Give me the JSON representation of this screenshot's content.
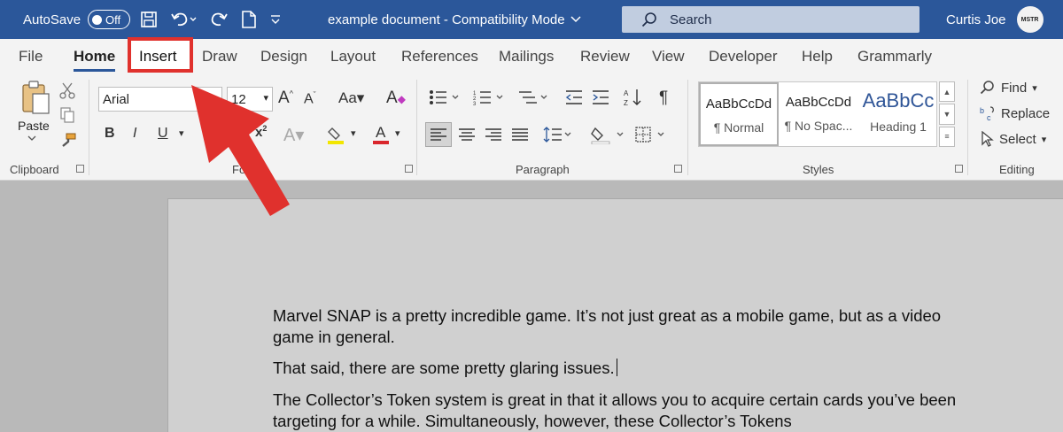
{
  "titlebar": {
    "autosave_label": "AutoSave",
    "autosave_state": "Off",
    "doc_title": "example document  -  Compatibility Mode",
    "search_placeholder": "Search",
    "user_name": "Curtis Joe",
    "avatar_text": "MSTR"
  },
  "tabs": [
    "File",
    "Home",
    "Insert",
    "Draw",
    "Design",
    "Layout",
    "References",
    "Mailings",
    "Review",
    "View",
    "Developer",
    "Help",
    "Grammarly"
  ],
  "active_tab": "Home",
  "highlighted_tab": "Insert",
  "ribbon": {
    "clipboard": {
      "paste_label": "Paste",
      "group_label": "Clipboard"
    },
    "font": {
      "font_name": "Arial",
      "font_size": "12",
      "group_label": "Fo",
      "font_color": "#e03a3a",
      "highlight_color": "#f2e600"
    },
    "paragraph": {
      "group_label": "Paragraph"
    },
    "styles": {
      "group_label": "Styles",
      "items": [
        {
          "sample": "AaBbCcDd",
          "name": "¶ Normal"
        },
        {
          "sample": "AaBbCcDd",
          "name": "¶ No Spac..."
        },
        {
          "sample": "AaBbCc",
          "name": "Heading 1"
        }
      ]
    },
    "editing": {
      "group_label": "Editing",
      "find": "Find",
      "replace": "Replace",
      "select": "Select"
    }
  },
  "document": {
    "paragraphs": [
      "Marvel SNAP is a pretty incredible game. It’s not just great as a mobile game, but as a video game in general.",
      "That said, there are some pretty glaring issues.",
      "The Collector’s Token system is great in that it allows you to acquire certain cards you’ve been targeting for a while. Simultaneously, however, these Collector’s Tokens"
    ]
  },
  "colors": {
    "titlebar": "#2b579a",
    "annotation_red": "#e0312d"
  }
}
